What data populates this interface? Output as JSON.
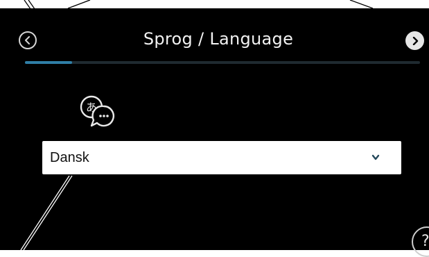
{
  "header": {
    "title": "Sprog / Language",
    "back_icon": "chevron-left-circle-icon",
    "next_icon": "chevron-right-circle-icon"
  },
  "progress": {
    "value": 0.12,
    "color": "#2f7ea6"
  },
  "language_icon": "language-chat-icon",
  "language_select": {
    "selected": "Dansk",
    "icon": "chevron-down-icon"
  },
  "help": {
    "label": "?",
    "icon": "help-icon"
  },
  "colors": {
    "background": "#000000",
    "accent": "#2f7ea6",
    "text": "#f2f2f2"
  }
}
